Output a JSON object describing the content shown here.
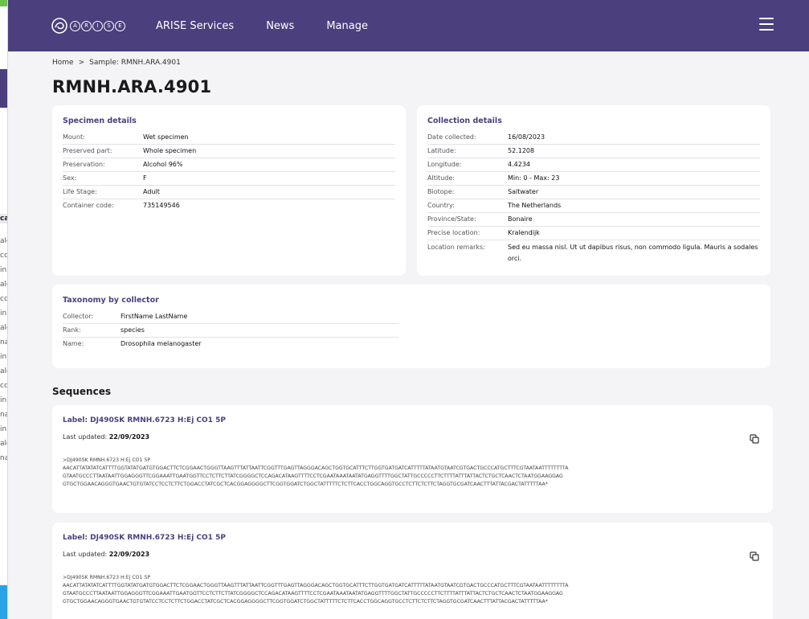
{
  "under": {
    "fragments": [
      "ca",
      "ale",
      "cc",
      "in",
      "ale",
      "cc",
      "in",
      "ale",
      "na",
      "in",
      "ale",
      "cc",
      "in",
      "na",
      "in",
      "ale",
      "na"
    ]
  },
  "nav": {
    "logo_letters": [
      "A",
      "R",
      "I",
      "S",
      "E"
    ],
    "items": [
      "ARISE Services",
      "News",
      "Manage"
    ]
  },
  "breadcrumb": {
    "home": "Home",
    "sep": ">",
    "current": "Sample: RMNH.ARA.4901"
  },
  "title": "RMNH.ARA.4901",
  "specimen": {
    "title": "Specimen details",
    "rows": [
      {
        "k": "Mount:",
        "v": "Wet specimen"
      },
      {
        "k": "Preserved part:",
        "v": "Whole specimen"
      },
      {
        "k": "Preservation:",
        "v": "Alcohol 96%"
      },
      {
        "k": "Sex:",
        "v": "F"
      },
      {
        "k": "Life Stage:",
        "v": "Adult"
      },
      {
        "k": "Container code:",
        "v": "735149546"
      }
    ]
  },
  "collection": {
    "title": "Collection details",
    "rows": [
      {
        "k": "Date collected:",
        "v": "16/08/2023"
      },
      {
        "k": "Latitude:",
        "v": "52.1208"
      },
      {
        "k": "Longitude:",
        "v": "4.4234"
      },
      {
        "k": "Altitude:",
        "v": "Min: 0 - Max: 23"
      },
      {
        "k": "Biotope:",
        "v": "Saltwater"
      },
      {
        "k": "Country:",
        "v": "The Netherlands"
      },
      {
        "k": "Province/State:",
        "v": "Bonaire"
      },
      {
        "k": "Precise location:",
        "v": "Kralendijk"
      },
      {
        "k": "Location remarks:",
        "v": "Sed eu massa nisl. Ut ut dapibus risus, non commodo ligula. Mauris a sodales orci."
      }
    ]
  },
  "taxonomy": {
    "title": "Taxonomy by collector",
    "rows": [
      {
        "k": "Collector:",
        "v": "FirstName LastName"
      },
      {
        "k": "Rank:",
        "v": "species"
      },
      {
        "k": "Name:",
        "v": "Drosophila melanogaster"
      }
    ]
  },
  "sequences": {
    "title": "Sequences",
    "items": [
      {
        "label": "Label: DJ490SK RMNH.6723 H:Ej CO1 5P",
        "updated_prefix": "Last updated:",
        "updated": "22/09/2023",
        "header": ">DJ490SK RMNH.6723 H:Ej CO1 5P",
        "lines": [
          "AACATTATATATCATTTTGGTATATGATGTGGACTTCTCGGAACTGGGTTAAGTTTATTAATTCGGTTTGAGTTAGGGACAGCTGGTGCATTTCTTGGTGATGATCATTTTTATAATGTAATCGTGACTGCCCATGCTTTCGTAATAATTTTTTTTA",
          "GTAATGCCCTTAATAATTGGAGGGTTCGGAAATTGAATGGTTCCTCTTCTTATCGGGGCTCCAGACATAAGTTTTCCTCGAATAAATAATATGAGGTTTTGGCTATTGCCCCCTTCTTTTATTTATTACTCTGCTCAACTCTAATGGAAGGAG",
          "GTGCTGGAACAGGGTGAACTGTGTATCCTCCTCTTCTGGACCTATCGCTCACGGAGGGGCTTCGGTGGATCTGGCTATTTTTCTCTTCACCTGGCAGGTGCCTCTTCTCTTCTAGGTGCGATCAACTTTATTACGACTATTTTTAA*"
        ]
      },
      {
        "label": "Label: DJ490SK RMNH.6723 H:Ej CO1 5P",
        "updated_prefix": "Last updated:",
        "updated": "22/09/2023",
        "header": ">DJ490SK RMNH.6723 H:Ej CO1 5P",
        "lines": [
          "AACATTATATATCATTTTGGTATATGATGTGGACTTCTCGGAACTGGGTTAAGTTTATTAATTCGGTTTGAGTTAGGGACAGCTGGTGCATTTCTTGGTGATGATCATTTTTATAATGTAATCGTGACTGCCCATGCTTTCGTAATAATTTTTTTTA",
          "GTAATGCCCTTAATAATTGGAGGGTTCGGAAATTGAATGGTTCCTCTTCTTATCGGGGCTCCAGACATAAGTTTTCCTCGAATAAATAATATGAGGTTTTGGCTATTGCCCCCTTCTTTTATTTATTACTCTGCTCAACTCTAATGGAAGGAG",
          "GTGCTGGAACAGGGTGAACTGTGTATCCTCCTCTTCTGGACCTATCGCTCACGGAGGGGCTTCGGTGGATCTGGCTATTTTTCTCTTCACCTGGCAGGTGCCTCTTCTCTTCTAGGTGCGATCAACTTTATTACGACTATTTTTAA*"
        ]
      }
    ]
  },
  "colors": {
    "brand": "#4b3f7d",
    "background": "#f4f4f6",
    "card": "#ffffff"
  }
}
